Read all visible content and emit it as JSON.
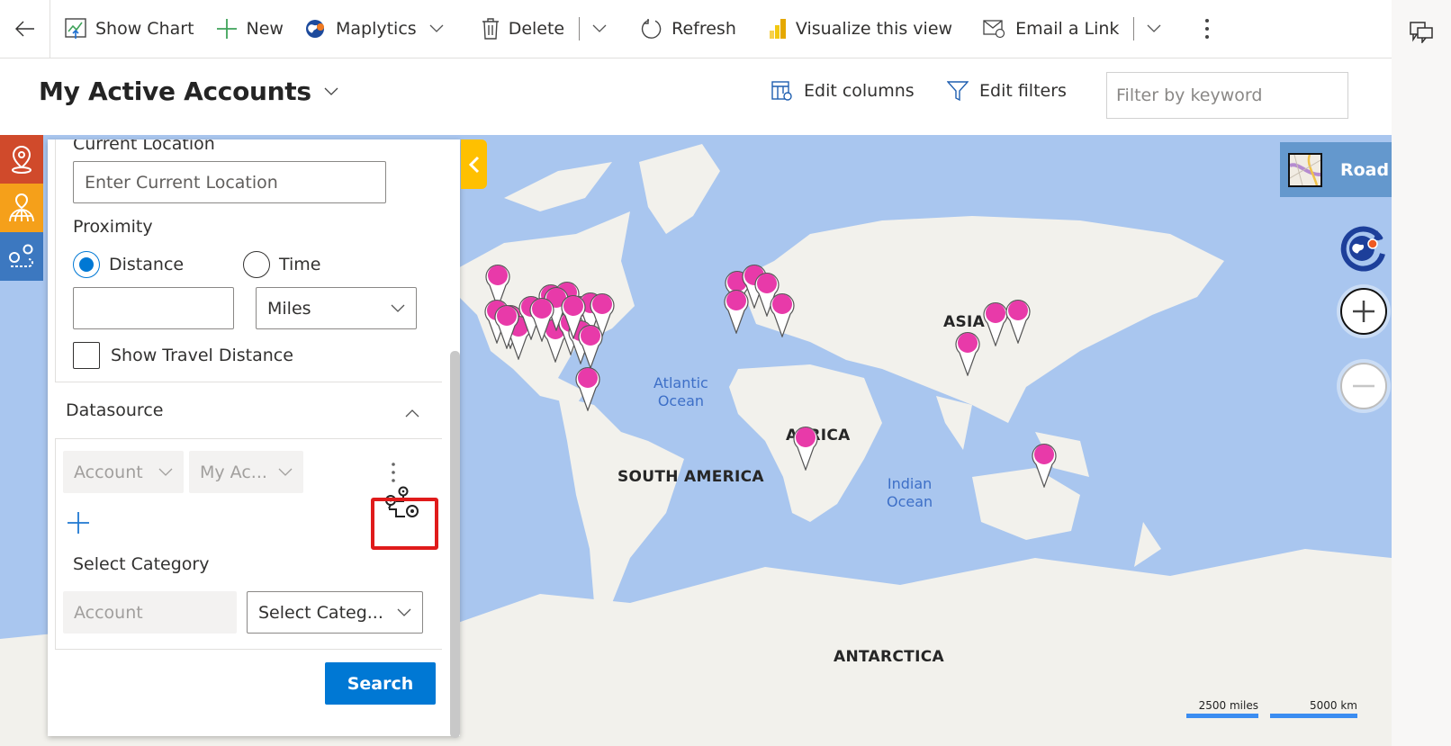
{
  "commandbar": {
    "back_label": "Back",
    "items": [
      {
        "label": "Show Chart",
        "icon": "chart-icon"
      },
      {
        "label": "New",
        "icon": "plus-icon"
      },
      {
        "label": "Maplytics",
        "icon": "maplytics-globe-icon",
        "has_dropdown": true
      },
      {
        "label": "Delete",
        "icon": "trash-icon",
        "has_split_dropdown": true
      },
      {
        "label": "Refresh",
        "icon": "refresh-icon"
      },
      {
        "label": "Visualize this view",
        "icon": "power-bi-icon"
      },
      {
        "label": "Email a Link",
        "icon": "email-link-icon",
        "has_split_dropdown": true
      }
    ],
    "more_label": "More commands"
  },
  "view": {
    "title": "My Active Accounts",
    "edit_columns": "Edit columns",
    "edit_filters": "Edit filters",
    "filter_placeholder": "Filter by keyword"
  },
  "panel": {
    "current_location_label": "Current Location",
    "current_location_placeholder": "Enter Current Location",
    "proximity_label": "Proximity",
    "radio_distance": "Distance",
    "radio_time": "Time",
    "selected_radio": "Distance",
    "distance_value": "",
    "unit_selected": "Miles",
    "show_travel_distance": "Show Travel Distance",
    "show_travel_distance_checked": false,
    "datasource_label": "Datasource",
    "entity_dropdown": "Account",
    "view_dropdown": "My Ac...",
    "select_category_label": "Select Category",
    "category_entity": "Account",
    "category_dropdown": "Select Categ...",
    "search_button": "Search"
  },
  "map": {
    "map_type": "Road",
    "labels": {
      "asia": "ASIA",
      "africa": "AFRICA",
      "south_america": "SOUTH AMERICA",
      "antarctica": "ANTARCTICA",
      "atlantic_1": "Atlantic",
      "atlantic_2": "Ocean",
      "indian_1": "Indian",
      "indian_2": "Ocean"
    },
    "scale_miles": "2500 miles",
    "scale_km": "5000 km",
    "pin_color": "#e83aa9"
  },
  "colors": {
    "accent": "#0078d4",
    "strip_red": "#d04a2b",
    "strip_orange": "#f5a01a",
    "strip_blue": "#3c78c0",
    "collapse_yellow": "#ffc000",
    "highlight_red": "#e01b1b"
  }
}
